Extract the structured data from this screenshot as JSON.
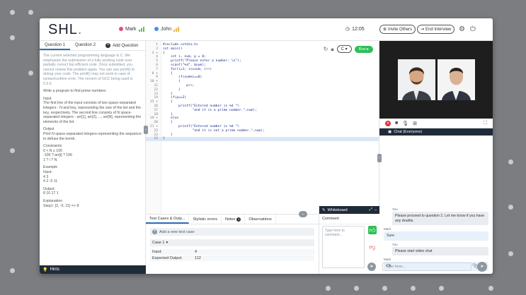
{
  "colors": {
    "brand_blue": "#2f9ad8",
    "run_green": "#2fbf55",
    "dark_navy": "#1f2b38",
    "end_call_red": "#e0323a"
  },
  "header": {
    "logo": "SHL",
    "participants": [
      {
        "name": "Mark",
        "dot": "#e0507a",
        "bars": "#5cc25a"
      },
      {
        "name": "John",
        "dot": "#4a8ee6",
        "bars": "#e9b84a"
      }
    ],
    "timer": "12:05",
    "invite_label": "Invite Others",
    "end_label": "End Interview"
  },
  "question": {
    "tabs": [
      "Question 1",
      "Question 2",
      "Add Question"
    ],
    "intro": "The current selected programming language is C. We emphasize the submission of a fully working code over partially correct but efficient code. Once submitted, you cannot review this problem again. You can use printf() to debug your code. The printf() may not work in case of syntax/runtime error. The version of GCC being used is 5.5.0.",
    "task": "Write a program to find prime numbers",
    "input_title": "Input",
    "input_text": "The first line of the input consists of two space-separated integers - N and key, representing the size of the list and the key, respectively. The second line consists of N space-separated integers - arr[1], arr[2], ..., arr[N], representing the elements of the list.",
    "output_title": "Output",
    "output_text": "Print N space-separated integers representing the sequence to defuse the bomb.",
    "constraints_title": "Constraints",
    "constraints": [
      "0 < N ≤ 105",
      "-106 ? arr[i] ? 106",
      "1 ? i ? N"
    ],
    "example_title": "Example",
    "example_input_label": "Input:",
    "example_input": [
      "4 3",
      "4 2 -5 11"
    ],
    "example_output_label": "Output:",
    "example_output": "8 10 17 1",
    "explanation_title": "Explanation",
    "explanation": "Step1: {2, -5, 11} => 8",
    "hints_label": "Hints"
  },
  "editor": {
    "language": "C",
    "run_label": "Run",
    "lines": [
      "#include <stdio.h>",
      "int main()",
      "{",
      "    int i, num, p = 0;",
      "    printf(\"Please enter a number: \\n\");",
      "    scanf(\"%d\", &num);",
      "    for(i=1; i<=num; i++)",
      "    {",
      "        if(num%i==0)",
      "        {",
      "            p++;",
      "        }",
      "    }",
      "    if(p==2)",
      "    {",
      "        printf(\"Entered number is %d \"\\",
      "               \"and it is a prime number.\",num);",
      "    }",
      "    else",
      "    {",
      "        printf(\"Entered number is %d \"\\",
      "               \"and it is not a prime number.\",num);",
      "    }",
      "}"
    ]
  },
  "tests": {
    "tabs": [
      "Test Cases & Outp...",
      "Stylistic errors",
      "Notes",
      "Observations"
    ],
    "notes_badge": "1",
    "add_label": "Add a new test case",
    "case_label": "Case 1",
    "input_label": "Input:",
    "input_value": "4",
    "expected_label": "Expected Output:",
    "expected_value": "112"
  },
  "whiteboard": {
    "title": "Whiteboard",
    "comment_label": "Comment",
    "placeholder": "Type here to comment..."
  },
  "chat": {
    "title": "Chat (Everyone)",
    "messages": [
      {
        "from": "You",
        "text": "Please proceed to question 2. Let me know if you have any doubts."
      },
      {
        "from": "Mark",
        "text": "Sure"
      },
      {
        "from": "You",
        "text": "Please start video chat"
      },
      {
        "from": "Mark",
        "text": "Ok"
      }
    ],
    "input_placeholder": "Type here..."
  }
}
